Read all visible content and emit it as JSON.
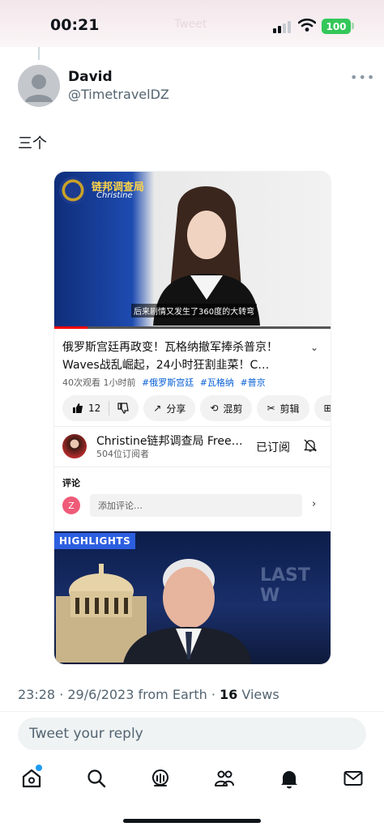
{
  "status_bar": {
    "time": "00:21",
    "ghost_text": "Tweet",
    "battery": "100"
  },
  "author": {
    "name": "David",
    "handle": "@TimetravelDZ"
  },
  "tweet": {
    "text": "三个"
  },
  "embed": {
    "video": {
      "channel_title": "链邦调查局",
      "channel_subtitle": "Christine",
      "caption": "后来剧情又发生了360度的大转弯",
      "progress": 0.12
    },
    "title": "俄罗斯宫廷再政变！瓦格纳撤军捧杀普京！Waves战乱崛起，24小时狂割韭菜！C…",
    "views": "40次观看",
    "time_ago": "1小时前",
    "tags": [
      "#俄罗斯宫廷",
      "#瓦格纳",
      "#普京"
    ],
    "actions": {
      "likes": "12",
      "share": "分享",
      "remix": "混剪",
      "clip": "剪辑"
    },
    "channel": {
      "name": "Christine链邦调查局 Free…",
      "subscribers": "504位订阅者",
      "subscribed_label": "已订阅"
    },
    "comments": {
      "label": "评论",
      "avatar_letter": "Z",
      "placeholder": "添加评论…"
    },
    "highlight": {
      "badge": "HIGHLIGHTS",
      "show_text": "LAST W"
    }
  },
  "meta": {
    "time": "23:28",
    "date": "29/6/2023",
    "source": "from Earth",
    "views_count": "16",
    "views_label": "Views"
  },
  "reply": {
    "placeholder": "Tweet your reply"
  },
  "colors": {
    "accent": "#1d9bf0",
    "badge_green": "#34c759",
    "yt_link": "#065fd4"
  }
}
